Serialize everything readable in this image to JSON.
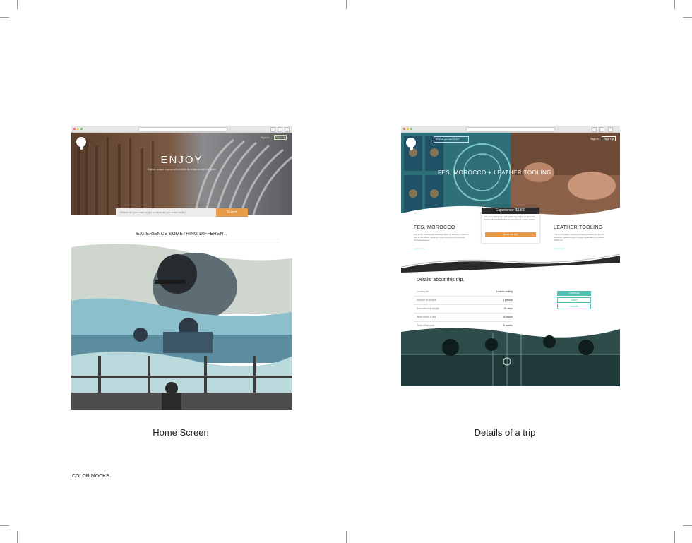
{
  "captions": {
    "home": "Home Screen",
    "details": "Details of a trip",
    "footer": "COLOR MOCKS"
  },
  "home": {
    "hero_title": "ENJOY",
    "hero_subtitle": "Explore unique experiences hosted by locals all over the globe",
    "nav_links": [
      "Sign In",
      "Sign Up"
    ],
    "search_placeholder": "Where do you want to go or what do you want to do?",
    "search_button": "Search",
    "section_heading": "EXPERIENCE SOMETHING DIFFERENT."
  },
  "details": {
    "search_placeholder": "What do you want to do?",
    "nav_links": [
      "Sign In",
      "Sign Up"
    ],
    "hero_title": "FES, MOROCCO + LEATHER TOOLING",
    "booking": {
      "title": "Experience: $1300",
      "text": "Join us in Morocco's old walled city of Fes to learn the traditional craft of leather tooling from a master artisan.",
      "button": "Book this trip"
    },
    "left_heading": "FES, MOROCCO",
    "left_text": "Fes is the cultural and spiritual center of Morocco, home to one of the oldest medinas in the world and the famous Chouara tannery.",
    "left_link": "Learn more",
    "right_heading": "LEATHER TOOLING",
    "right_text": "The art of leather tooling has been practised in Fes for centuries, passed down through generations of skilled craftsmen.",
    "right_link": "Learn more",
    "details_heading": "Details about this trip.",
    "details_rows": [
      {
        "label": "Looking for",
        "value": "Leather tooling"
      },
      {
        "label": "Number of people",
        "value": "1 person"
      },
      {
        "label": "Estimated trip length",
        "value": "3+ days"
      },
      {
        "label": "Work hours a day",
        "value": "10 hours"
      },
      {
        "label": "Time of the year",
        "value": "6 weeks"
      }
    ],
    "share_buttons": [
      "Facebook",
      "Twitter",
      "LinkedIn"
    ]
  },
  "colors": {
    "accent_orange": "#e89a48",
    "accent_teal": "#4fc1b2",
    "dark": "#2a2a2a"
  }
}
